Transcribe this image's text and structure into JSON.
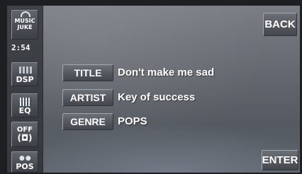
{
  "sidebar": {
    "music_juke_line1": "MUSIC",
    "music_juke_line2": "JUKE",
    "clock": "2:54",
    "dsp_label": "DSP",
    "eq_label": "EQ",
    "off_label": "OFF",
    "off_symbol": "(◘)",
    "pos_label": "POS"
  },
  "header": {
    "back_label": "BACK"
  },
  "track": {
    "title_label": "TITLE",
    "title_value": "Don't make me sad",
    "artist_label": "ARTIST",
    "artist_value": "Key of success",
    "genre_label": "GENRE",
    "genre_value": "POPS"
  },
  "footer": {
    "enter_label": "ENTER"
  },
  "icons": [
    "music-note-icon",
    "dsp-bars-icon",
    "eq-grid-icon",
    "surround-icon",
    "seat-position-icon"
  ]
}
